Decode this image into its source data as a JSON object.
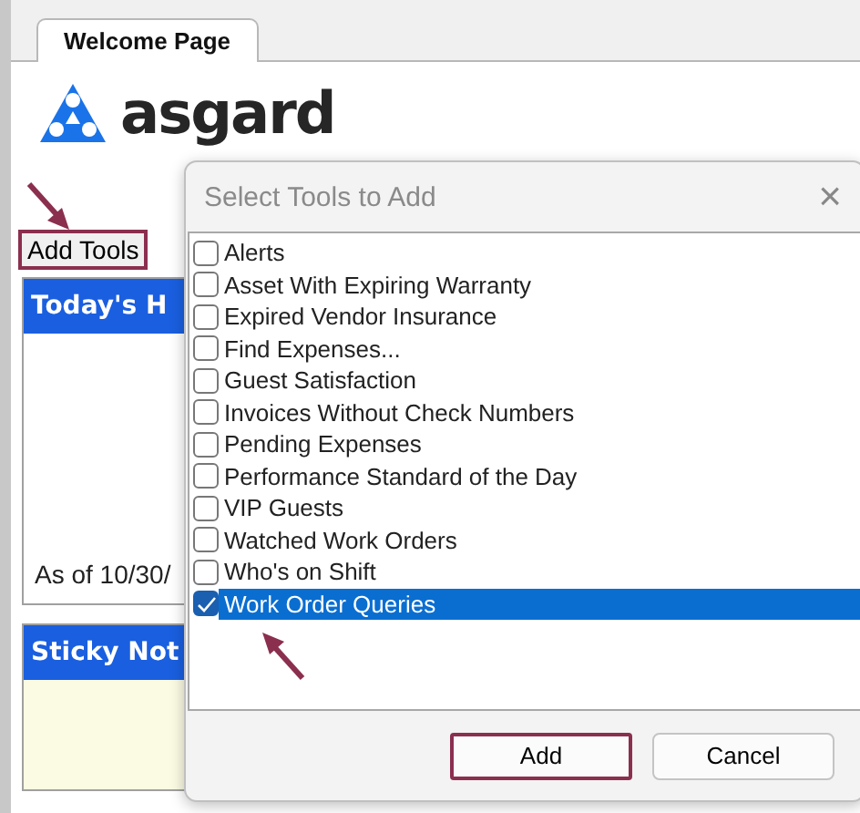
{
  "tab": {
    "label": "Welcome Page",
    "selected": true
  },
  "logo": {
    "text": "asgard"
  },
  "add_tools_button": {
    "label": "Add Tools"
  },
  "panels": [
    {
      "kind": "header",
      "title": "Today's H",
      "footer": "As of 10/30/"
    },
    {
      "kind": "note",
      "title": "Sticky Not"
    }
  ],
  "dialog": {
    "title": "Select Tools to Add",
    "close": "×",
    "items": [
      {
        "label": "Alerts",
        "checked": false,
        "selected": false
      },
      {
        "label": "Asset With Expiring Warranty",
        "checked": false,
        "selected": false
      },
      {
        "label": "Expired Vendor Insurance",
        "checked": false,
        "selected": false
      },
      {
        "label": "Find Expenses...",
        "checked": false,
        "selected": false
      },
      {
        "label": "Guest Satisfaction",
        "checked": false,
        "selected": false
      },
      {
        "label": "Invoices Without Check Numbers",
        "checked": false,
        "selected": false
      },
      {
        "label": "Pending Expenses",
        "checked": false,
        "selected": false
      },
      {
        "label": "Performance Standard of the Day",
        "checked": false,
        "selected": false
      },
      {
        "label": "VIP Guests",
        "checked": false,
        "selected": false
      },
      {
        "label": "Watched Work Orders",
        "checked": false,
        "selected": false
      },
      {
        "label": "Who's on Shift",
        "checked": false,
        "selected": false
      },
      {
        "label": "Work Order Queries",
        "checked": true,
        "selected": true
      }
    ],
    "buttons": [
      {
        "label": "Add",
        "kind": "primary"
      },
      {
        "label": "Cancel",
        "kind": "secondary"
      }
    ]
  }
}
